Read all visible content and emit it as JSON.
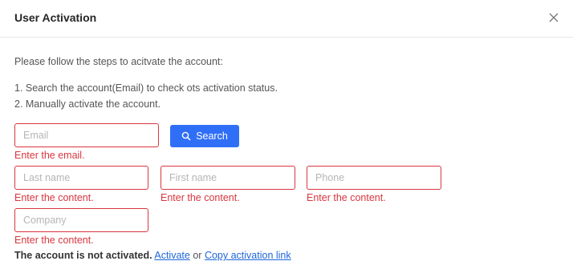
{
  "dialog": {
    "title": "User Activation",
    "close_icon": "close-icon"
  },
  "instructions": {
    "intro": "Please follow the steps to acitvate the account:",
    "step1": "1. Search the account(Email) to check ots activation status.",
    "step2": "2. Manually activate the account."
  },
  "form": {
    "email": {
      "placeholder": "Email",
      "value": "",
      "error": "Enter the email."
    },
    "search_button": {
      "label": "Search",
      "icon": "search-icon"
    },
    "last_name": {
      "placeholder": "Last name",
      "value": "",
      "error": "Enter the content."
    },
    "first_name": {
      "placeholder": "First name",
      "value": "",
      "error": "Enter the content."
    },
    "phone": {
      "placeholder": "Phone",
      "value": "",
      "error": "Enter the content."
    },
    "company": {
      "placeholder": "Company",
      "value": "",
      "error": "Enter the content."
    }
  },
  "status": {
    "message": "The account is not activated.",
    "activate_link": "Activate",
    "or_text": "or",
    "copy_link": "Copy activation link"
  },
  "colors": {
    "error": "#d9363e",
    "primary": "#2f6ff7",
    "link": "#1e66d9"
  }
}
